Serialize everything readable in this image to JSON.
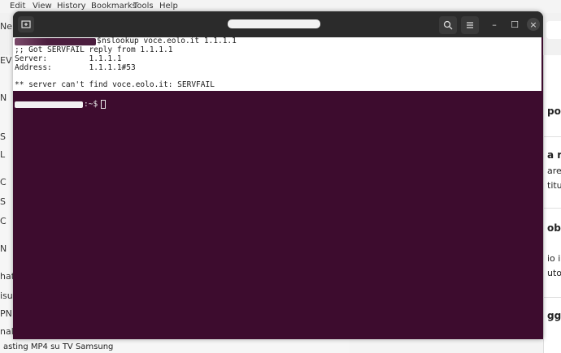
{
  "background": {
    "menu_items": [
      "Edit",
      "View",
      "History",
      "Bookmarks",
      "Tools",
      "Help"
    ],
    "tab_left_label": "Ne",
    "sidebar_rows": [
      "EV",
      "N",
      "S",
      "L",
      "C",
      "S",
      "C",
      "N",
      "hats",
      "isult",
      "PN",
      "nali"
    ],
    "right_rows": [
      "port",
      "a re",
      "are",
      "titu",
      "obl",
      "io i",
      "uto",
      "ggi"
    ],
    "footer_text": "asting MP4 su TV Samsung"
  },
  "terminal": {
    "window_controls": {
      "minimize": "–",
      "maximize": "☐",
      "close": "×"
    },
    "lines": {
      "prompt_symbol": "$",
      "command": "nslookup voce.eolo.it 1.1.1.1",
      "line1": ";; Got SERVFAIL reply from 1.1.1.1",
      "line2": "Server:         1.1.1.1",
      "line3": "Address:        1.1.1.1#53",
      "line4": "** server can't find voce.eolo.it: SERVFAIL",
      "second_prompt": ":~$"
    }
  },
  "colors": {
    "terminal_bg": "#3d0c2e",
    "header_bg": "#2b2b2b",
    "output_bg": "#ffffff"
  }
}
